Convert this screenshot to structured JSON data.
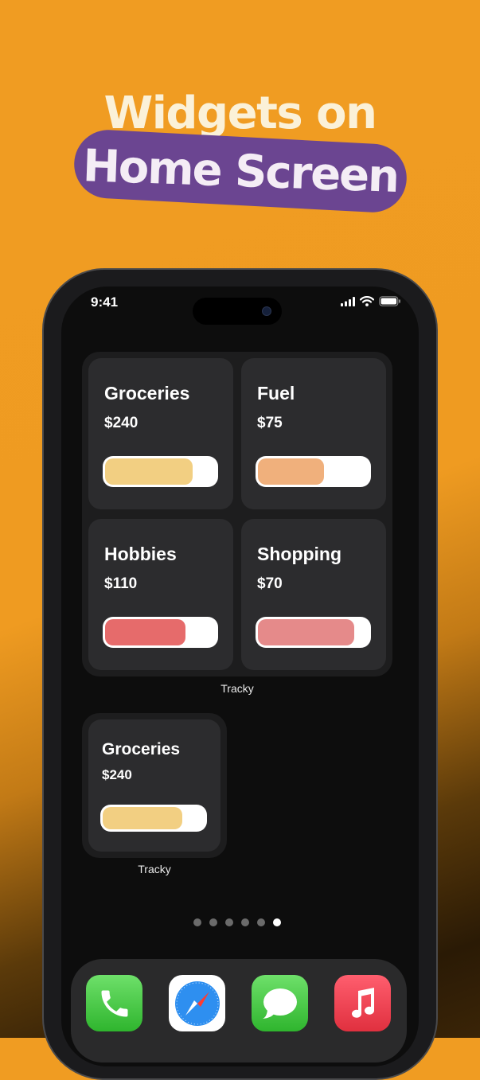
{
  "headline": {
    "line1": "Widgets on",
    "line2": "Home Screen"
  },
  "status_bar": {
    "time": "9:41"
  },
  "widget_large": {
    "cards": [
      {
        "category": "Groceries",
        "amount": "$240",
        "progress": 0.79,
        "color": "#f2cf82"
      },
      {
        "category": "Fuel",
        "amount": "$75",
        "progress": 0.6,
        "color": "#f0b07c"
      },
      {
        "category": "Hobbies",
        "amount": "$110",
        "progress": 0.73,
        "color": "#e66b6b"
      },
      {
        "category": "Shopping",
        "amount": "$70",
        "progress": 0.87,
        "color": "#e58a8a"
      }
    ],
    "app_label": "Tracky"
  },
  "widget_small": {
    "category": "Groceries",
    "amount": "$240",
    "progress": 0.78,
    "color": "#f2cf82",
    "app_label": "Tracky"
  },
  "page_dots": {
    "count": 6,
    "active_index": 5
  },
  "dock": {
    "apps": [
      "phone-icon",
      "safari-icon",
      "messages-icon",
      "music-icon"
    ]
  },
  "colors": {
    "background": "#f09c22",
    "pill": "#6b4591"
  }
}
